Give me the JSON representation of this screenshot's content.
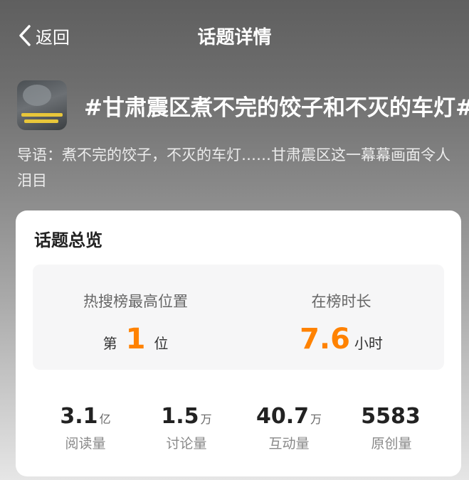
{
  "header": {
    "back_label": "返回",
    "title": "话题详情"
  },
  "topic": {
    "title": "#甘肃震区煮不完的饺子和不灭的车灯#",
    "intro": "导语：煮不完的饺子，不灭的车灯……甘肃震区这一幕幕画面令人泪目"
  },
  "overview": {
    "title": "话题总览",
    "rank": {
      "label": "热搜榜最高位置",
      "prefix": "第",
      "value": "1",
      "suffix": "位"
    },
    "duration": {
      "label": "在榜时长",
      "value": "7.6",
      "unit": "小时"
    },
    "metrics": [
      {
        "value": "3.1",
        "unit": "亿",
        "label": "阅读量"
      },
      {
        "value": "1.5",
        "unit": "万",
        "label": "讨论量"
      },
      {
        "value": "40.7",
        "unit": "万",
        "label": "互动量"
      },
      {
        "value": "5583",
        "unit": "",
        "label": "原创量"
      }
    ]
  },
  "colors": {
    "accent": "#ff8200",
    "card": "#ffffff",
    "panel": "#f6f6f7"
  }
}
